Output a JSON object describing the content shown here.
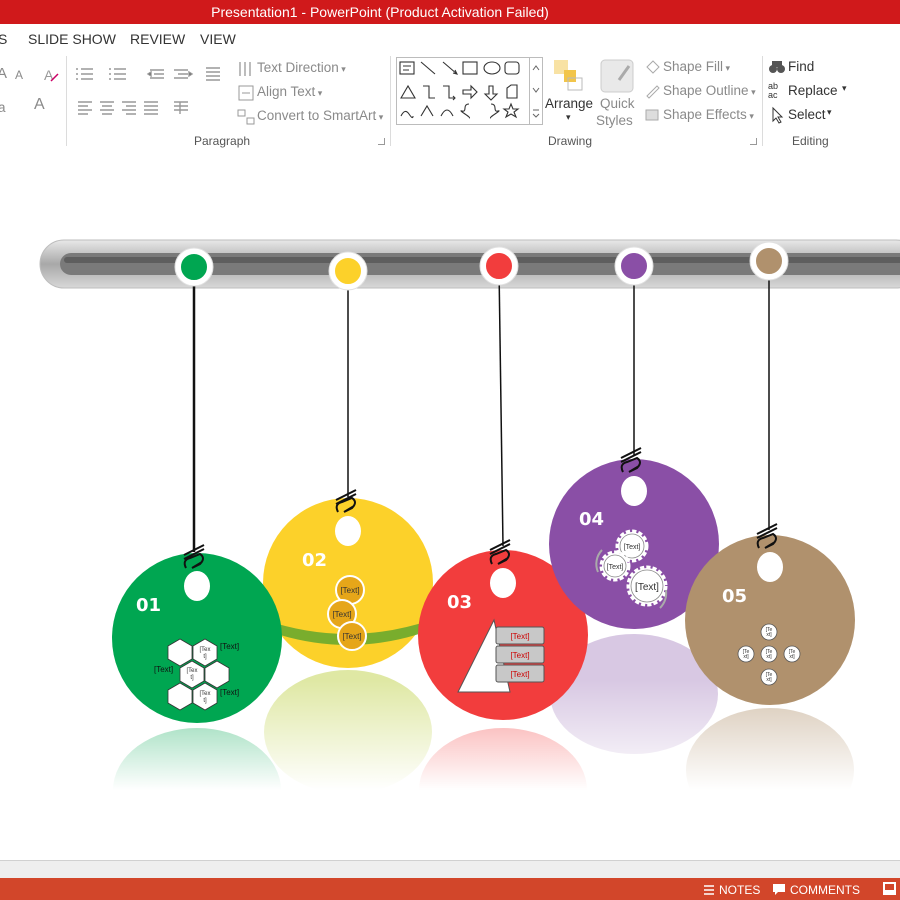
{
  "window": {
    "title": "Presentation1 -  PowerPoint (Product Activation Failed)"
  },
  "tabs": [
    "S",
    "SLIDE SHOW",
    "REVIEW",
    "VIEW"
  ],
  "ribbon": {
    "font_group": {
      "text_a": "A",
      "text_a_small": "A",
      "text_a_large": "A",
      "text_aa": "a"
    },
    "paragraph": {
      "label": "Paragraph",
      "text_direction": "Text Direction",
      "align_text": "Align Text",
      "convert_smartart": "Convert to SmartArt"
    },
    "drawing": {
      "label": "Drawing",
      "arrange": "Arrange",
      "quick_styles_1": "Quick",
      "quick_styles_2": "Styles",
      "shape_fill": "Shape Fill",
      "shape_outline": "Shape Outline",
      "shape_effects": "Shape Effects"
    },
    "editing": {
      "label": "Editing",
      "find": "Find",
      "replace": "Replace",
      "select": "Select",
      "abc_icon": "ab ac"
    }
  },
  "slide": {
    "ornaments": [
      {
        "number": "01",
        "color": "#00a651",
        "pin_color": "#00a651"
      },
      {
        "number": "02",
        "color": "#fcd12a",
        "pin_color": "#fcd12a"
      },
      {
        "number": "03",
        "color": "#f23d3d",
        "pin_color": "#f23d3d"
      },
      {
        "number": "04",
        "color": "#8a4fa6",
        "pin_color": "#8a4fa6"
      },
      {
        "number": "05",
        "color": "#b0916d",
        "pin_color": "#b0916d"
      }
    ],
    "placeholder": "[Text]",
    "placeholder_short_1": "[Tex",
    "placeholder_short_2": "t]",
    "placeholder_tiny_1": "[Te",
    "placeholder_tiny_2": "xt]"
  },
  "statusbar": {
    "notes": "NOTES",
    "comments": "COMMENTS"
  },
  "colors": {
    "titlebar": "#d0191b",
    "statusbar": "#d2462a"
  }
}
